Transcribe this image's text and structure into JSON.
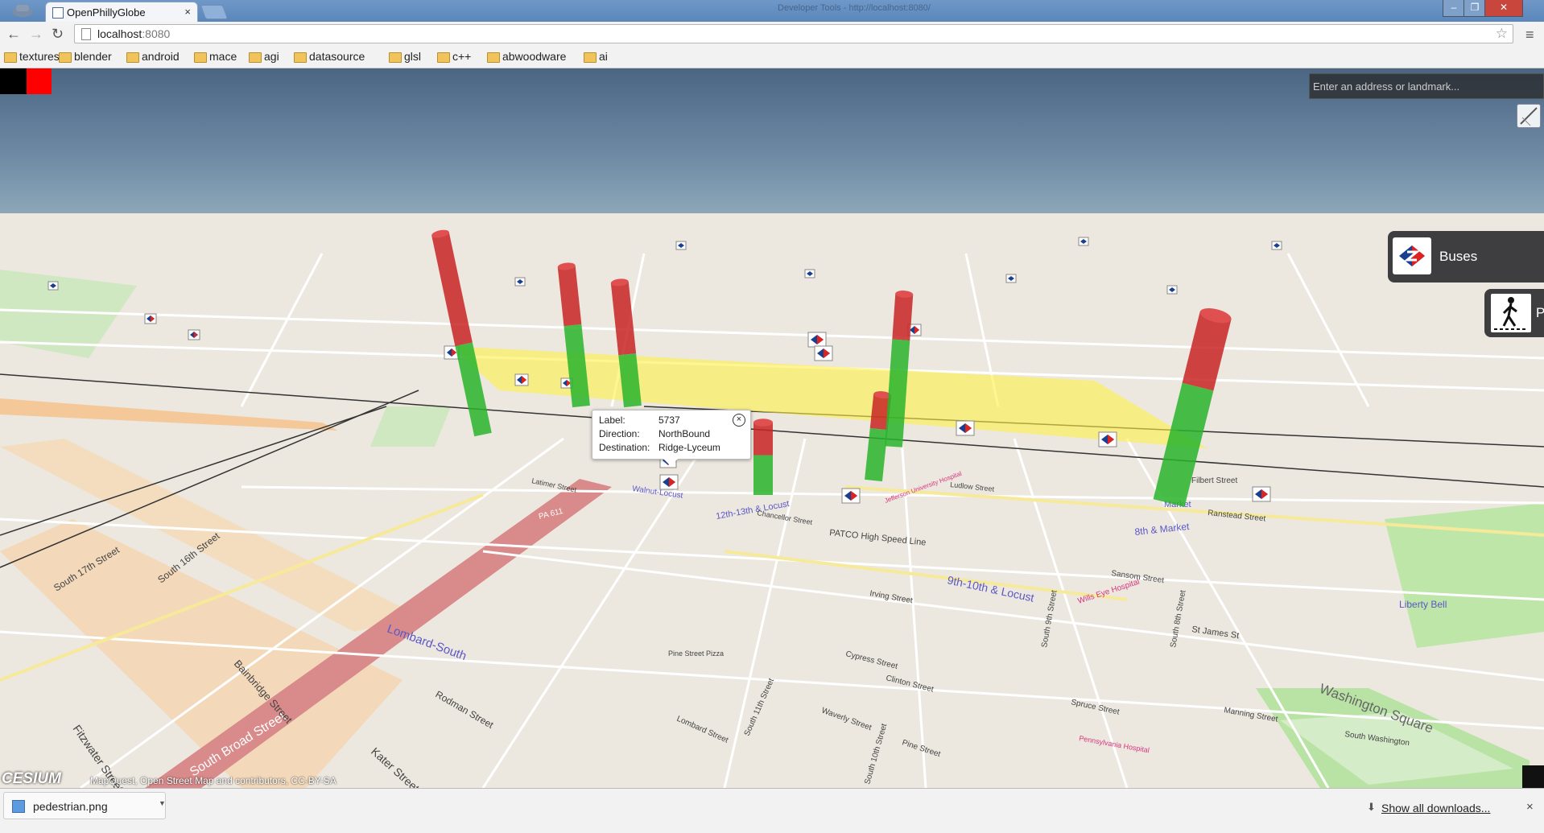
{
  "browser": {
    "tab_title": "OpenPhillyGlobe",
    "tab_close": "×",
    "devtools_tab": "Developer Tools - http://localhost:8080/",
    "url_host": "localhost",
    "url_port": ":8080",
    "bookmarks": [
      "textures",
      "blender",
      "android",
      "mace",
      "agi",
      "datasource",
      "glsl",
      "c++",
      "abwoodware",
      "ai"
    ]
  },
  "geocoder": {
    "placeholder": "Enter an address or landmark..."
  },
  "panels": {
    "buses_label": "Buses",
    "pedestrian_label": "P"
  },
  "popup": {
    "label_key": "Label:",
    "label_value": "5737",
    "direction_key": "Direction:",
    "direction_value": "NorthBound",
    "destination_key": "Destination:",
    "destination_value": "Ridge-Lyceum",
    "close": "×"
  },
  "colors": {
    "on_time": "#29b42c",
    "late": "#c82424",
    "route_highlight": "#fff04a",
    "sky": "#5a7594"
  },
  "map": {
    "labels": [
      "Washington Square",
      "Lombard-South",
      "South Broad Street",
      "9th-10th & Locust",
      "12th-13th & Locust",
      "8th & Market",
      "Market",
      "PATCO High Speed Line",
      "Walnut-Locust",
      "Irving Street",
      "Spruce Street",
      "Pine Street",
      "Lombard Street",
      "Rodman Street",
      "Kater Street",
      "Waverly Street",
      "Cypress Street",
      "Clinton Street",
      "Manning Street",
      "South Washington",
      "Wills Eye Hospital",
      "Pennsylvania Hospital",
      "South 8th Street",
      "South 9th Street",
      "South 10th Street",
      "South 11th Street",
      "South 17th Street",
      "South 16th Street",
      "Filbert Street",
      "Ranstead Street",
      "Sansom Street",
      "Chancellor Street",
      "Latimer Street",
      "St James St",
      "Fitzwater Street",
      "Bainbridge Street",
      "PA 611",
      "Ludlow Street",
      "Liberty Bell"
    ],
    "transit_stops": [
      "Jefferson University Hospital",
      "Pine Street Pizza"
    ],
    "bars": [
      {
        "green_fraction": 0.45
      },
      {
        "green_fraction": 0.58
      },
      {
        "green_fraction": 0.42
      },
      {
        "green_fraction": 0.55
      },
      {
        "green_fraction": 0.6
      },
      {
        "green_fraction": 0.7
      },
      {
        "green_fraction": 0.62
      }
    ]
  },
  "cesium": {
    "logo": "CESIUM",
    "credits": "MapQuest, Open Street Map and contributors, CC-BY-SA"
  },
  "downloads": {
    "file_name": "pedestrian.png",
    "show_all": "Show all downloads...",
    "close": "×"
  }
}
